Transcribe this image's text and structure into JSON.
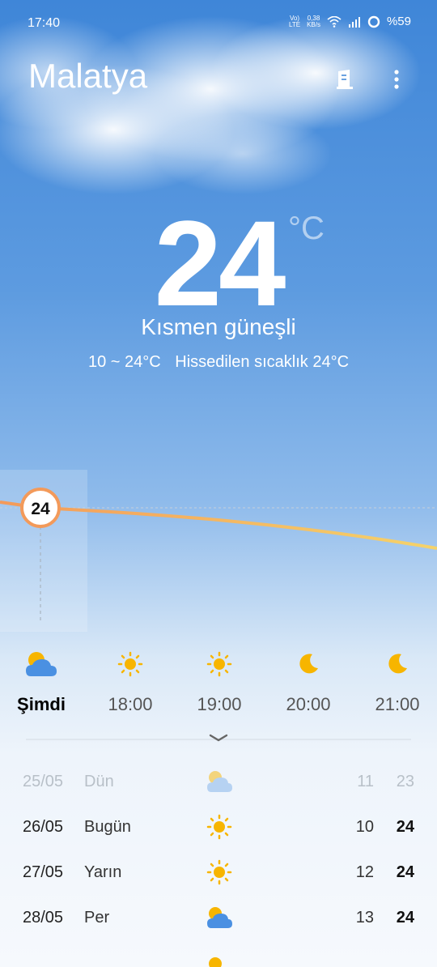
{
  "status_bar": {
    "time": "17:40",
    "volte_top": "Vo)",
    "volte_bottom": "LTE",
    "speed_top": "0,38",
    "speed_bottom": "KB/s",
    "battery": "%59"
  },
  "header": {
    "city": "Malatya",
    "menu_icon": "more-vertical-icon",
    "city_icon": "building-icon"
  },
  "current": {
    "temperature": "24",
    "unit": "°C",
    "condition": "Kısmen güneşli",
    "range": "10 ~ 24°C",
    "feels_like": "Hissedilen sıcaklık 24°C"
  },
  "graph": {
    "current_marker": "24"
  },
  "hourly": [
    {
      "label": "Şimdi",
      "icon": "partly-cloudy-icon"
    },
    {
      "label": "18:00",
      "icon": "sun-icon"
    },
    {
      "label": "19:00",
      "icon": "sun-icon"
    },
    {
      "label": "20:00",
      "icon": "moon-icon"
    },
    {
      "label": "21:00",
      "icon": "moon-icon"
    }
  ],
  "daily": [
    {
      "date": "25/05",
      "name": "Dün",
      "icon": "partly-cloudy-icon",
      "low": "11",
      "high": "23"
    },
    {
      "date": "26/05",
      "name": "Bugün",
      "icon": "sun-icon",
      "low": "10",
      "high": "24"
    },
    {
      "date": "27/05",
      "name": "Yarın",
      "icon": "sun-icon",
      "low": "12",
      "high": "24"
    },
    {
      "date": "28/05",
      "name": "Per",
      "icon": "partly-cloudy-icon",
      "low": "13",
      "high": "24"
    }
  ],
  "colors": {
    "sun": "#f7b500",
    "cloud": "#4a90e2",
    "line_start": "#f39a5a",
    "line_end": "#f5d36a"
  }
}
